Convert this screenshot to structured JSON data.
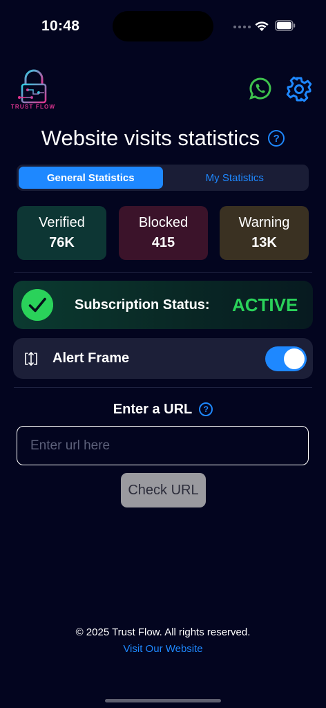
{
  "status_bar": {
    "time": "10:48"
  },
  "header": {
    "logo_text": "TRUST FLOW",
    "title": "Website visits statistics",
    "help_symbol": "?"
  },
  "tabs": [
    {
      "label": "General Statistics",
      "active": true
    },
    {
      "label": "My Statistics",
      "active": false
    }
  ],
  "stats": [
    {
      "label": "Verified",
      "value": "76K",
      "color": "#0d3634"
    },
    {
      "label": "Blocked",
      "value": "415",
      "color": "#3b132a"
    },
    {
      "label": "Warning",
      "value": "13K",
      "color": "#3a3122"
    }
  ],
  "subscription": {
    "label": "Subscription Status:",
    "value": "ACTIVE"
  },
  "alert_frame": {
    "label": "Alert Frame",
    "enabled": true
  },
  "url_check": {
    "heading": "Enter a URL",
    "placeholder": "Enter url here",
    "value": "",
    "button_label": "Check URL"
  },
  "footer": {
    "copyright": "© 2025 Trust Flow. All rights reserved.",
    "link": "Visit Our Website"
  },
  "colors": {
    "background": "#03051f",
    "accent": "#1e88ff",
    "active_green": "#2ad25a",
    "whatsapp_green": "#3ec24d"
  },
  "icons": [
    "whatsapp-icon",
    "gear-icon",
    "help-icon",
    "checkmark-icon",
    "frame-icon",
    "wifi-icon",
    "battery-icon"
  ]
}
